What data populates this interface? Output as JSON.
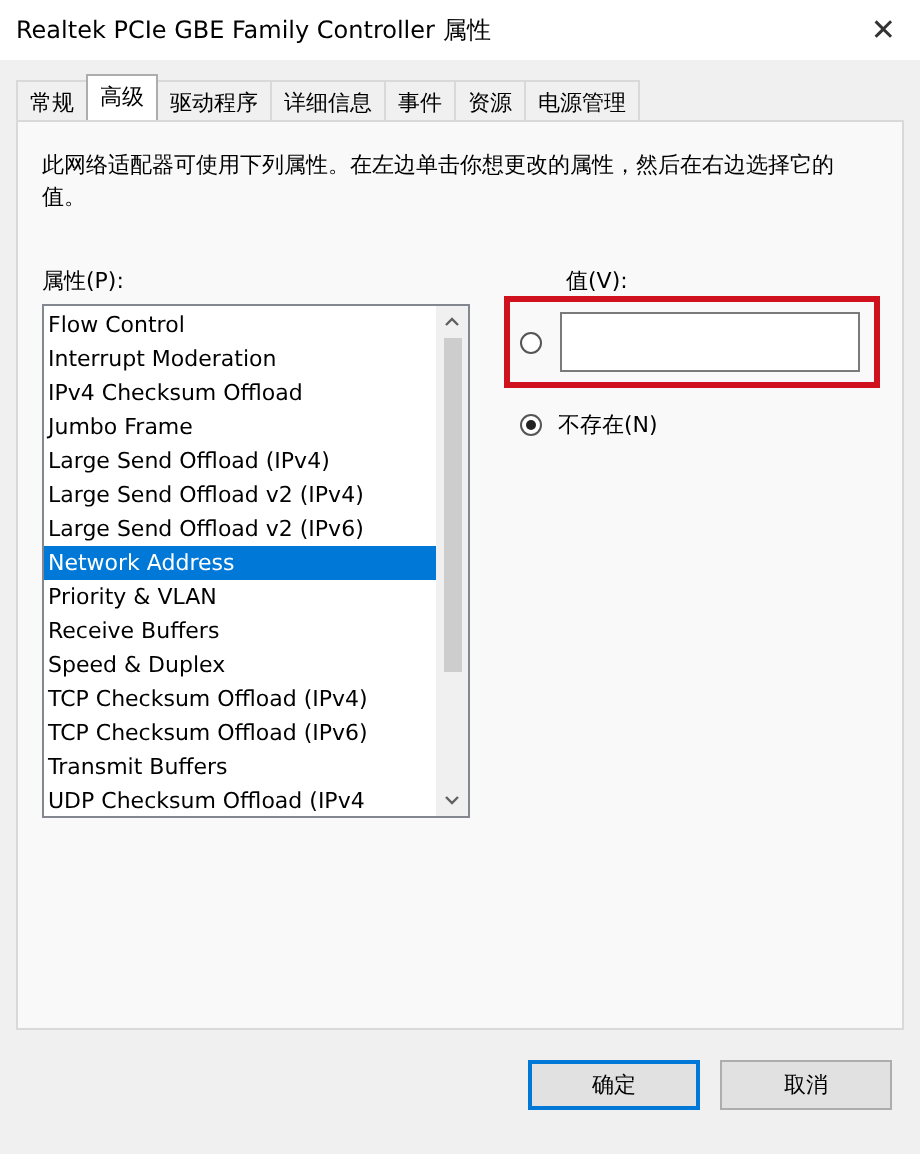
{
  "window": {
    "title": "Realtek PCIe GBE Family Controller 属性",
    "close": "✕"
  },
  "tabs": [
    {
      "label": "常规",
      "selected": false
    },
    {
      "label": "高级",
      "selected": true
    },
    {
      "label": "驱动程序",
      "selected": false
    },
    {
      "label": "详细信息",
      "selected": false
    },
    {
      "label": "事件",
      "selected": false
    },
    {
      "label": "资源",
      "selected": false
    },
    {
      "label": "电源管理",
      "selected": false
    }
  ],
  "description": "此网络适配器可使用下列属性。在左边单击你想更改的属性，然后在右边选择它的值。",
  "property_label": "属性(P):",
  "properties": [
    {
      "label": "Flow Control",
      "selected": false
    },
    {
      "label": "Interrupt Moderation",
      "selected": false
    },
    {
      "label": "IPv4 Checksum Offload",
      "selected": false
    },
    {
      "label": "Jumbo Frame",
      "selected": false
    },
    {
      "label": "Large Send Offload (IPv4)",
      "selected": false
    },
    {
      "label": "Large Send Offload v2 (IPv4)",
      "selected": false
    },
    {
      "label": "Large Send Offload v2 (IPv6)",
      "selected": false
    },
    {
      "label": "Network Address",
      "selected": true
    },
    {
      "label": "Priority & VLAN",
      "selected": false
    },
    {
      "label": "Receive Buffers",
      "selected": false
    },
    {
      "label": "Speed & Duplex",
      "selected": false
    },
    {
      "label": "TCP Checksum Offload (IPv4)",
      "selected": false
    },
    {
      "label": "TCP Checksum Offload (IPv6)",
      "selected": false
    },
    {
      "label": "Transmit Buffers",
      "selected": false
    },
    {
      "label": "UDP Checksum Offload (IPv4",
      "selected": false
    }
  ],
  "value_label": "值(V):",
  "value_option": {
    "selected": false,
    "highlighted": true
  },
  "not_present_option": {
    "label": "不存在(N)",
    "selected": true
  },
  "buttons": [
    {
      "label": "确定",
      "default": true
    },
    {
      "label": "取消",
      "default": false
    }
  ]
}
